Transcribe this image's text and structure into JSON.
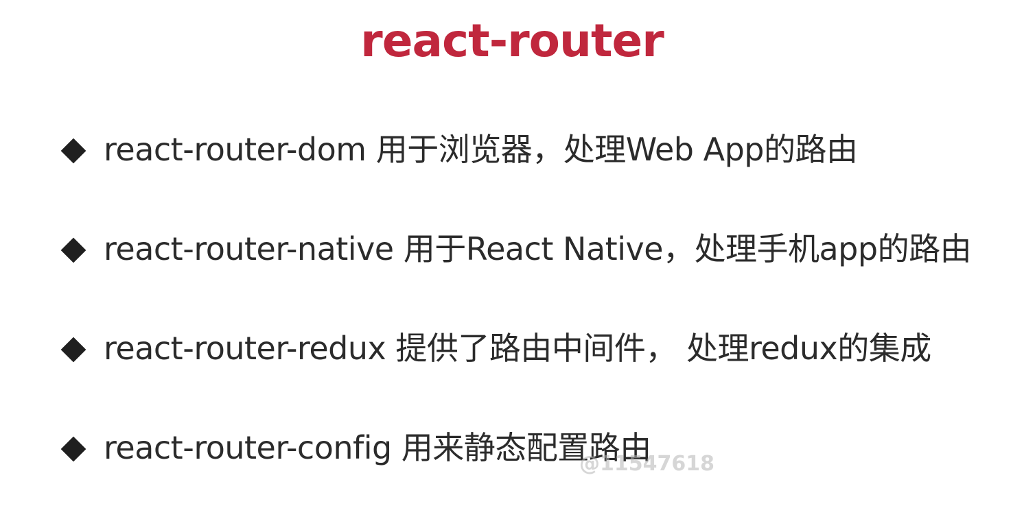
{
  "slide": {
    "title": "react-router",
    "title_color": "#c0273d",
    "bullet_icon": "diamond-bullet-icon",
    "bullets": [
      {
        "text": "react-router-dom 用于浏览器，处理Web App的路由"
      },
      {
        "text": "react-router-native 用于React Native，处理手机app的路由"
      },
      {
        "text": "react-router-redux 提供了路由中间件， 处理redux的集成"
      },
      {
        "text": "react-router-config 用来静态配置路由"
      }
    ],
    "watermark": "@11547618"
  }
}
